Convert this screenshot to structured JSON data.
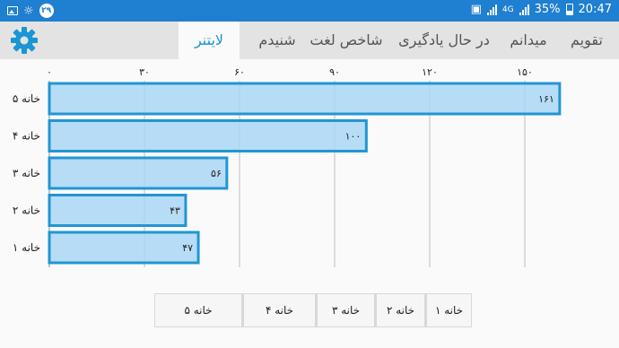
{
  "status_bar": {
    "left_badge": "۲۹",
    "network": "4G",
    "battery": "35%",
    "time": "20:47"
  },
  "tabs": [
    {
      "label": "لایتنر",
      "active": true
    },
    {
      "label": "شنیدم",
      "active": false
    },
    {
      "label": "شاخص لغت",
      "active": false
    },
    {
      "label": "در حال یادگیری",
      "active": false
    },
    {
      "label": "میدانم",
      "active": false
    },
    {
      "label": "تقویم",
      "active": false
    }
  ],
  "icons": {
    "settings": "gear-icon",
    "accent": "#2196d3"
  },
  "chart_data": {
    "type": "bar",
    "orientation": "horizontal",
    "categories": [
      "خانه ۵",
      "خانه ۴",
      "خانه ۳",
      "خانه ۲",
      "خانه ۱"
    ],
    "values": [
      161,
      100,
      56,
      43,
      47
    ],
    "value_labels": [
      "۱۶۱",
      "۱۰۰",
      "۵۶",
      "۴۳",
      "۴۷"
    ],
    "xticks": [
      0,
      30,
      60,
      90,
      120,
      150
    ],
    "xtick_labels": [
      "۰",
      "۳۰",
      "۶۰",
      "۹۰",
      "۱۲۰",
      "۱۵۰"
    ],
    "xlim": [
      0,
      165
    ],
    "grid": true,
    "bar_fill": "#a9d6f5",
    "bar_stroke": "#2196d3"
  },
  "legend": [
    "خانه ۱",
    "خانه ۲",
    "خانه ۳",
    "خانه ۴",
    "خانه ۵"
  ]
}
